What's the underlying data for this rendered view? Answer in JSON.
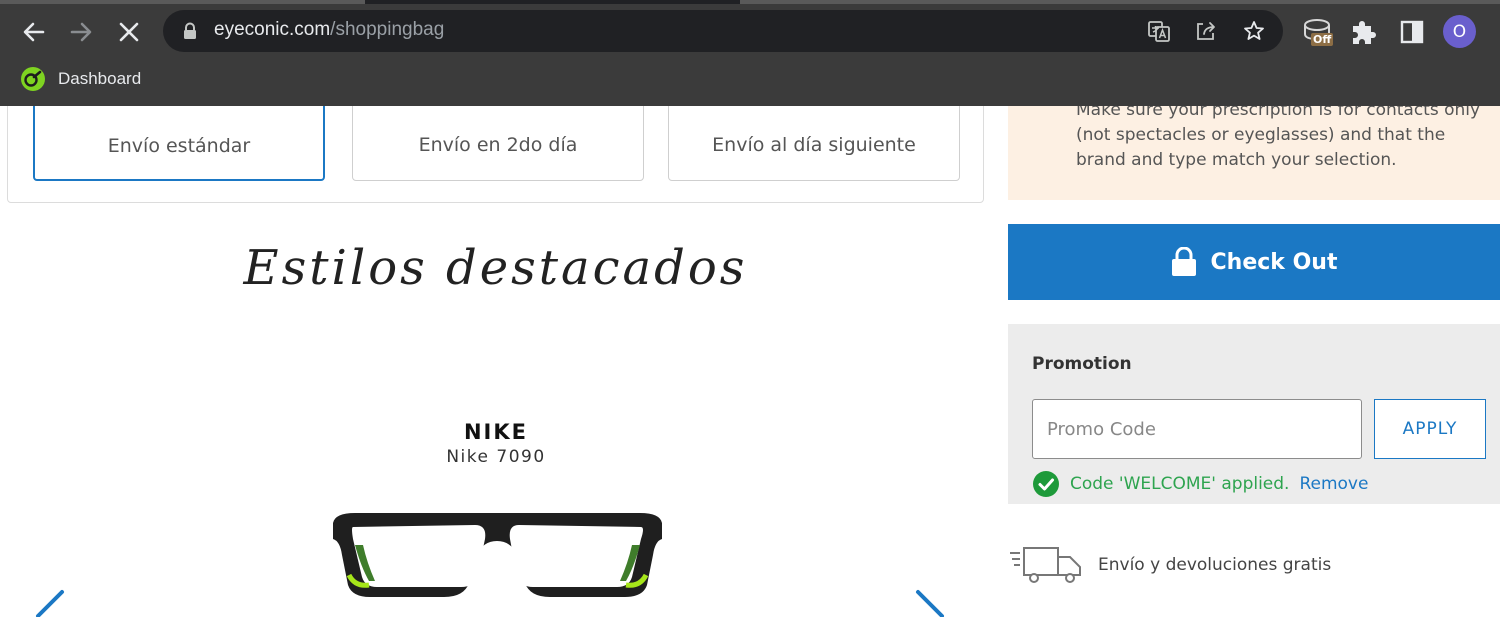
{
  "browser": {
    "url_host": "eyeconic.com",
    "url_path": "/shoppingbag",
    "profile_initial": "O",
    "extension_badge": "Off",
    "bookmarks": [
      {
        "label": "Dashboard"
      }
    ]
  },
  "shipping": {
    "options": [
      {
        "label": "Envío estándar",
        "selected": true
      },
      {
        "label": "Envío en 2do día",
        "selected": false
      },
      {
        "label": "Envío al día siguiente",
        "selected": false
      }
    ]
  },
  "featured": {
    "title": "Estilos destacados",
    "product": {
      "brand": "NIKE",
      "model": "Nike 7090"
    }
  },
  "sidebar": {
    "rx_notice": "Make sure your prescription is for contacts only (not spectacles or eyeglasses) and that the brand and type match your selection.",
    "checkout_label": "Check Out",
    "promo": {
      "title": "Promotion",
      "placeholder": "Promo Code",
      "apply_label": "APPLY",
      "status_text": "Code 'WELCOME' applied.",
      "remove_label": "Remove"
    },
    "shipping_info": "Envío y devoluciones gratis"
  },
  "colors": {
    "accent": "#1b78c4",
    "success": "#2ea44f",
    "notice_bg": "#fdf0e3",
    "promo_bg": "#ececec"
  }
}
